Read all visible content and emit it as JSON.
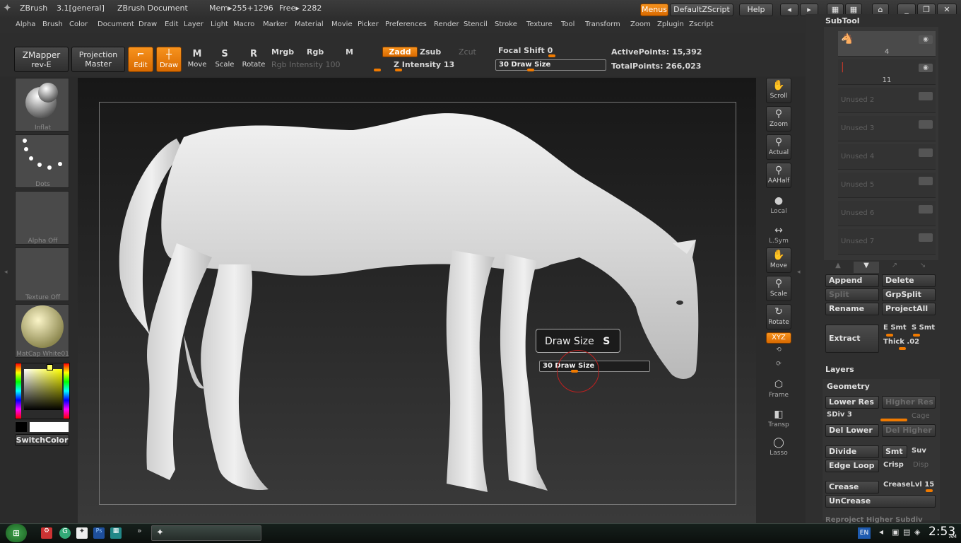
{
  "app": {
    "name": "ZBrush",
    "version": "3.1[general]",
    "document": "ZBrush Document",
    "mem": "Mem▸255+1296",
    "free": "Free▸ 2282",
    "menus_btn": "Menus",
    "script_btn": "DefaultZScript",
    "help_btn": "Help"
  },
  "menubar": [
    "Alpha",
    "Brush",
    "Color",
    "Document",
    "Draw",
    "Edit",
    "Layer",
    "Light",
    "Macro",
    "Marker",
    "Material",
    "Movie",
    "Picker",
    "Preferences",
    "Render",
    "Stencil",
    "Stroke",
    "Texture",
    "Tool",
    "Transform",
    "Zoom",
    "Zplugin",
    "Zscript"
  ],
  "toolbar": {
    "zmapper": "ZMapper",
    "zmapper_sub": "rev-E",
    "projection": "Projection",
    "projection_sub": "Master",
    "edit": "Edit",
    "draw": "Draw",
    "move": "Move",
    "scale": "Scale",
    "rotate": "Rotate",
    "mrgb": "Mrgb",
    "rgb": "Rgb",
    "m": "M",
    "rgb_intensity": "Rgb  Intensity 100",
    "zadd": "Zadd",
    "zsub": "Zsub",
    "zcut": "Zcut",
    "z_intensity": "Z Intensity 13",
    "focal_shift": "Focal Shift 0",
    "draw_size": "30 Draw Size",
    "active_points": "ActivePoints: 15,392",
    "total_points": "TotalPoints: 266,023",
    "z_intensity_value": 0.13,
    "rgb_intensity_value": 1.0,
    "draw_size_value": 0.3,
    "focal_shift_value": 0.0
  },
  "left": {
    "brush": "Inflat",
    "stroke": "Dots",
    "alpha": "Alpha  Off",
    "texture": "Texture  Off",
    "material": "MatCap  White01",
    "switch_color": "SwitchColor"
  },
  "popup": {
    "title": "Draw Size",
    "hotkey": "S",
    "slider": "30 Draw Size"
  },
  "righttools": {
    "scroll": "Scroll",
    "zoom": "Zoom",
    "actual": "Actual",
    "aahalf": "AAHalf",
    "local": "Local",
    "lsym": "L.Sym",
    "move": "Move",
    "scale": "Scale",
    "rotate": "Rotate",
    "xyz": "XYZ",
    "frame": "Frame",
    "transp": "Transp",
    "lasso": "Lasso"
  },
  "subtool": {
    "title": "SubTool",
    "items": [
      {
        "label": "4"
      },
      {
        "label": "11"
      },
      {
        "label": "Unused  2"
      },
      {
        "label": "Unused  3"
      },
      {
        "label": "Unused  4"
      },
      {
        "label": "Unused  5"
      },
      {
        "label": "Unused  6"
      },
      {
        "label": "Unused  7"
      }
    ],
    "append": "Append",
    "delete": "Delete",
    "split": "Split",
    "grpsplit": "GrpSplit",
    "rename": "Rename",
    "projectall": "ProjectAll",
    "extract": "Extract",
    "esmt": "E Smt",
    "ssmt": "S Smt",
    "thick": "Thick .02"
  },
  "layers": {
    "title": "Layers"
  },
  "geometry": {
    "title": "Geometry",
    "lower_res": "Lower Res",
    "higher_res": "Higher Res",
    "sdiv": "SDiv 3",
    "cage": "Cage",
    "del_lower": "Del Lower",
    "del_higher": "Del Higher",
    "divide": "Divide",
    "smt": "Smt",
    "suv": "Suv",
    "edge_loop": "Edge Loop",
    "crisp": "Crisp",
    "disp": "Disp",
    "crease": "Crease",
    "creaselvl": "CreaseLvl 15",
    "uncrease": "UnCrease",
    "reproject": "Reproject Higher Subdiv"
  },
  "taskbar": {
    "lang": "EN",
    "time": "2:53",
    "ampm": "AM"
  },
  "colors": {
    "accent": "#f07a00",
    "panel": "#2f2f2f"
  }
}
